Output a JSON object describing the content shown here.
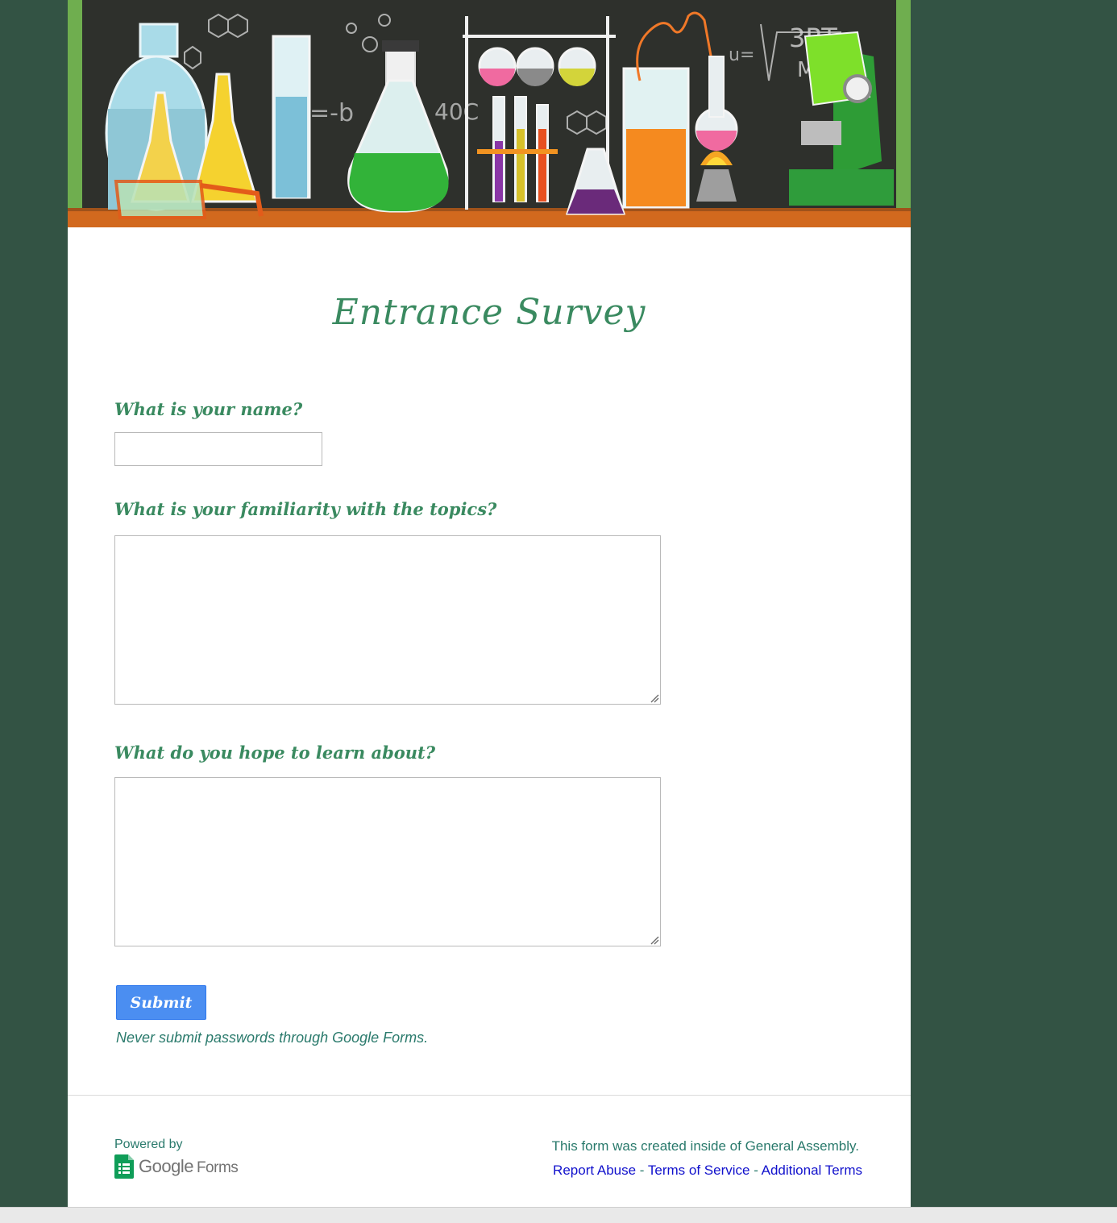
{
  "form": {
    "title": "Entrance Survey",
    "questions": [
      {
        "label": "What is your name?",
        "value": ""
      },
      {
        "label": "What is your familiarity with the topics?",
        "value": ""
      },
      {
        "label": "What do you hope to learn about?",
        "value": ""
      }
    ],
    "submit_label": "Submit",
    "password_warning": "Never submit passwords through Google Forms."
  },
  "footer": {
    "powered_by": "Powered by",
    "brand_google": "Google",
    "brand_forms": "Forms",
    "created_inside": "This form was created inside of General Assembly.",
    "report_abuse": "Report Abuse",
    "separator": " - ",
    "terms_of_service": "Terms of Service",
    "additional_terms": "Additional Terms"
  },
  "banner": {
    "chalk_text_1": "3RT",
    "chalk_text_2": "M",
    "chalk_text_3": "=-b",
    "chalk_text_4": "40C",
    "chalk_text_5": "u="
  },
  "colors": {
    "page_bg": "#335344",
    "accent_green": "#3a8a60",
    "button_blue": "#4b8ef1",
    "footer_teal": "#2a7a6c",
    "link_blue": "#1111cc"
  }
}
